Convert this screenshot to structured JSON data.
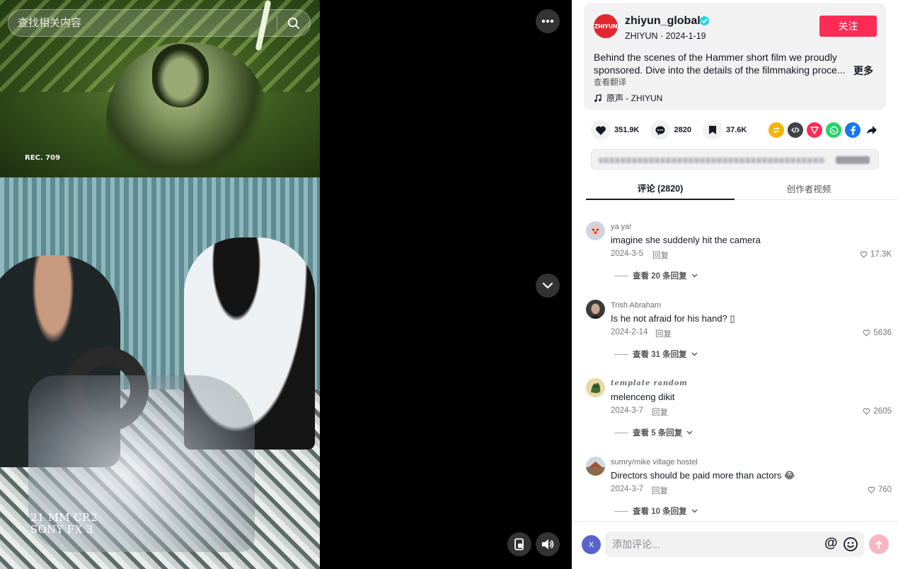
{
  "search": {
    "placeholder": "查找相关内容"
  },
  "video": {
    "overlay_top": "REC. 709",
    "overlay_bottom_line1": "21 MM CP.2",
    "overlay_bottom_line2": "SONY FX 3"
  },
  "author": {
    "avatar_text": "ZHIYUN",
    "name": "zhiyun_global",
    "verified": true,
    "subtitle": "ZHIYUN · 2024-1-19",
    "follow_label": "关注"
  },
  "description": {
    "line1": "Behind the scenes of the Hammer short film we proudly",
    "line2": "sponsored. Dive into the details of the filmmaking proce...",
    "more_label": "更多",
    "translate_label": "查看翻译",
    "music": "原声 - ZHIYUN"
  },
  "stats": {
    "likes": "351.9K",
    "comments": "2820",
    "saves": "37.6K"
  },
  "share_icons": [
    "repost-icon",
    "embed-icon",
    "send-icon",
    "whatsapp-icon",
    "facebook-icon",
    "share-arrow-icon"
  ],
  "colors": {
    "accent": "#fe2c55",
    "repost": "#f5b400",
    "embed": "#404145",
    "send": "#fe2c55",
    "whatsapp": "#25d366",
    "facebook": "#1877f2"
  },
  "tabs": [
    {
      "label": "评论 (2820)"
    },
    {
      "label": "创作者视频"
    }
  ],
  "comments": [
    {
      "user": "ya ya!",
      "text": "imagine she suddenly hit the camera",
      "date": "2024-3-5",
      "reply": "回复",
      "likes": "17.3K",
      "more": "查看 20 条回复"
    },
    {
      "user": "Trish Abraham",
      "text": "Is he not afraid for his hand? ▯",
      "date": "2024-2-14",
      "reply": "回复",
      "likes": "5636",
      "more": "查看 31 条回复"
    },
    {
      "user": "template random",
      "text": "melenceng dikit",
      "date": "2024-3-7",
      "reply": "回复",
      "likes": "2605",
      "more": "查看 5 条回复"
    },
    {
      "user": "sumry/mike village hostel",
      "text": "Directors should be paid more than actors 😂",
      "date": "2024-3-7",
      "reply": "回复",
      "likes": "760",
      "more": "查看 10 条回复"
    }
  ],
  "composer": {
    "avatar_letter": "X",
    "placeholder": "添加评论...",
    "at_symbol": "@"
  }
}
